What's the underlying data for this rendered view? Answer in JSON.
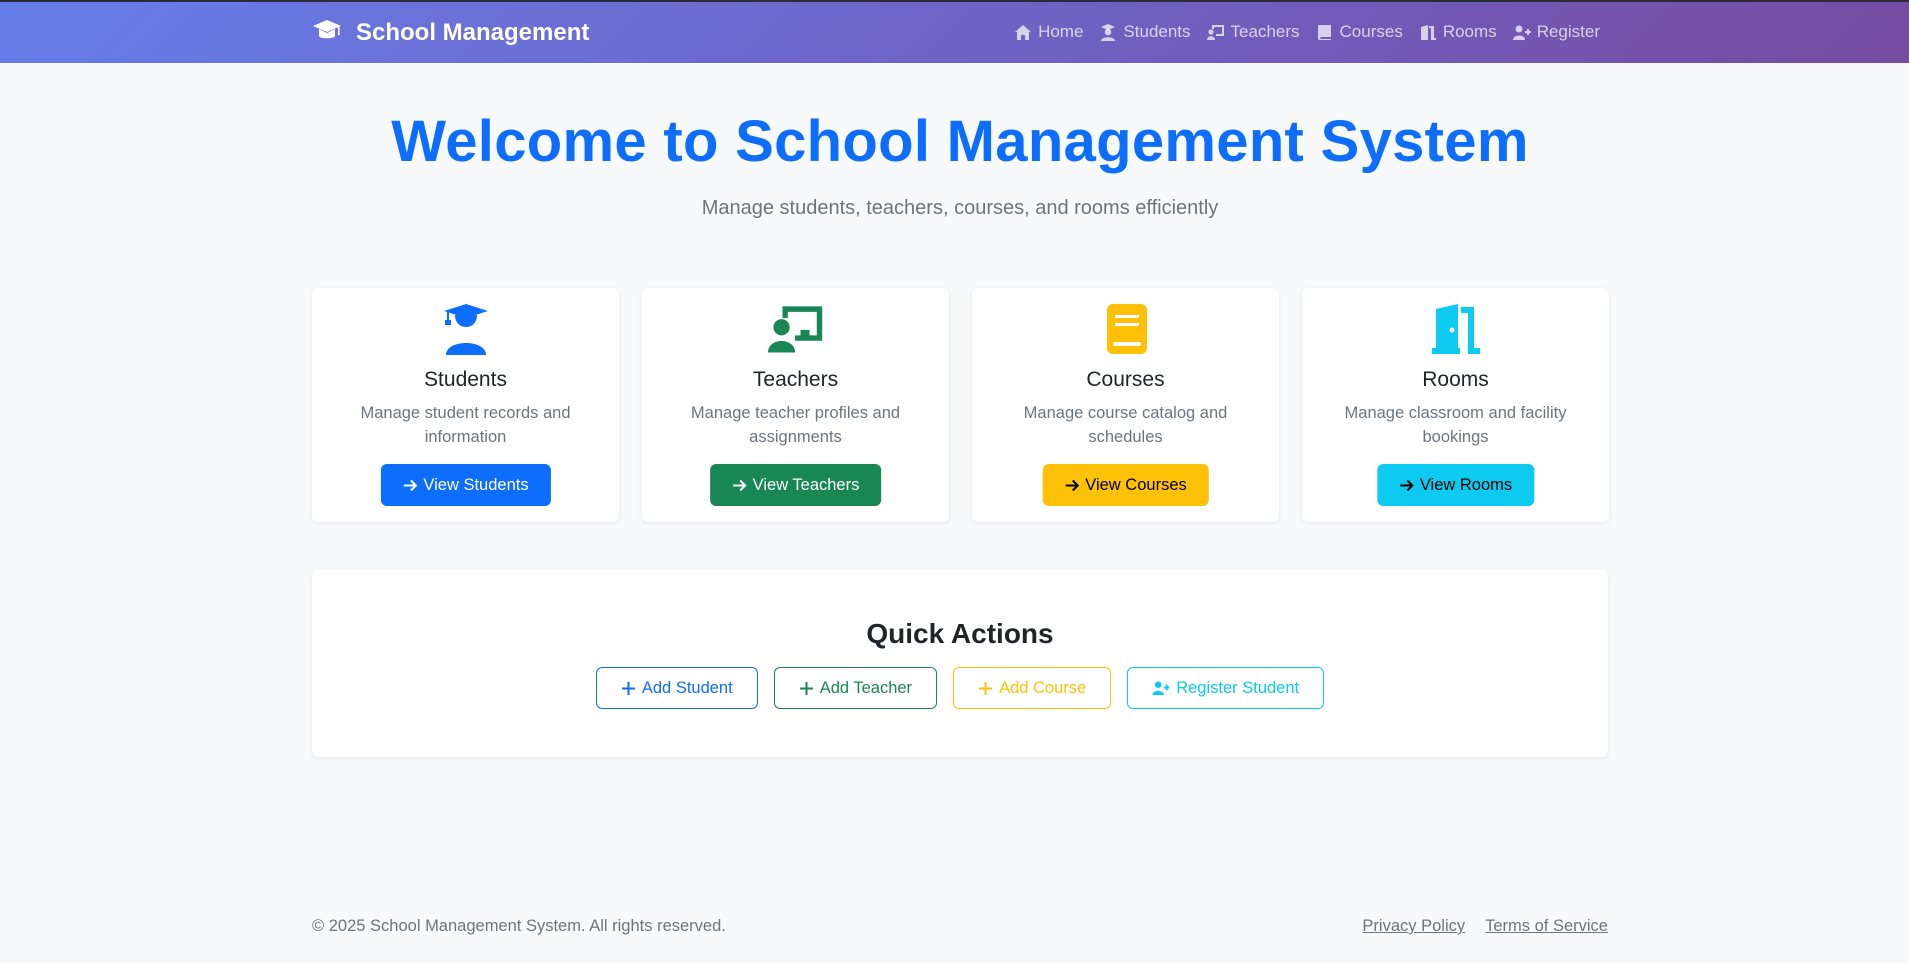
{
  "brand": {
    "name": "School Management",
    "icon": "graduation-cap-icon"
  },
  "nav": {
    "items": [
      {
        "label": "Home",
        "icon": "home-icon"
      },
      {
        "label": "Students",
        "icon": "student-icon"
      },
      {
        "label": "Teachers",
        "icon": "teacher-icon"
      },
      {
        "label": "Courses",
        "icon": "book-icon"
      },
      {
        "label": "Rooms",
        "icon": "door-icon"
      },
      {
        "label": "Register",
        "icon": "user-plus-icon"
      }
    ]
  },
  "hero": {
    "title": "Welcome to School Management System",
    "subtitle": "Manage students, teachers, courses, and rooms efficiently"
  },
  "cards": [
    {
      "title": "Students",
      "description": "Manage student records and information",
      "button": "View Students",
      "icon": "student-icon",
      "color": "#0d6efd"
    },
    {
      "title": "Teachers",
      "description": "Manage teacher profiles and assignments",
      "button": "View Teachers",
      "icon": "teacher-icon",
      "color": "#198754"
    },
    {
      "title": "Courses",
      "description": "Manage course catalog and schedules",
      "button": "View Courses",
      "icon": "book-icon",
      "color": "#ffc107"
    },
    {
      "title": "Rooms",
      "description": "Manage classroom and facility bookings",
      "button": "View Rooms",
      "icon": "door-icon",
      "color": "#0dcaf0"
    }
  ],
  "quick_actions": {
    "title": "Quick Actions",
    "buttons": [
      {
        "label": "Add Student",
        "icon": "plus-icon",
        "color": "#0d6efd"
      },
      {
        "label": "Add Teacher",
        "icon": "plus-icon",
        "color": "#198754"
      },
      {
        "label": "Add Course",
        "icon": "plus-icon",
        "color": "#ffc107"
      },
      {
        "label": "Register Student",
        "icon": "user-plus-icon",
        "color": "#0dcaf0"
      }
    ]
  },
  "footer": {
    "copyright": "© 2025 School Management System. All rights reserved.",
    "links": [
      "Privacy Policy",
      "Terms of Service"
    ]
  }
}
